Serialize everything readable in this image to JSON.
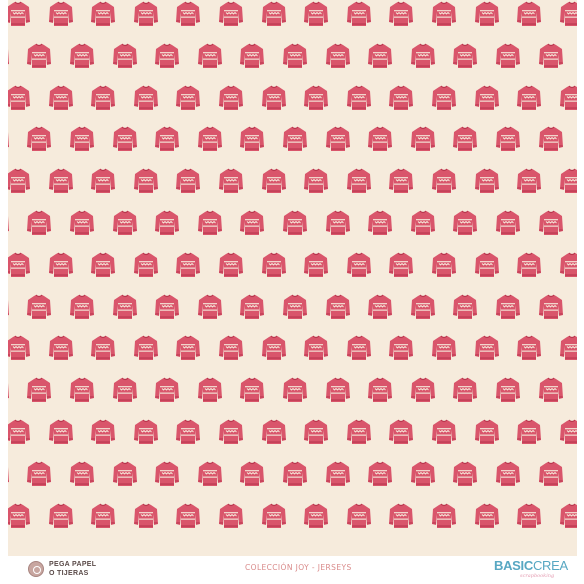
{
  "pattern": {
    "motif_icon": "christmas-sweater-icon",
    "background_color": "#f6ebdc",
    "motif_color": "#d9556b",
    "motif_dark_color": "#b8344c",
    "rows": 13,
    "columns": 13
  },
  "footer": {
    "stamp_icon": "scissors-stamp-icon",
    "stamp_line1": "PEGA PAPEL",
    "stamp_line2": "O TIJERAS",
    "collection": "COLECCIÓN JOY - JERSEYS",
    "brand_bold": "BASIC",
    "brand_light": "CREA",
    "brand_sub": "scrapbooking"
  }
}
